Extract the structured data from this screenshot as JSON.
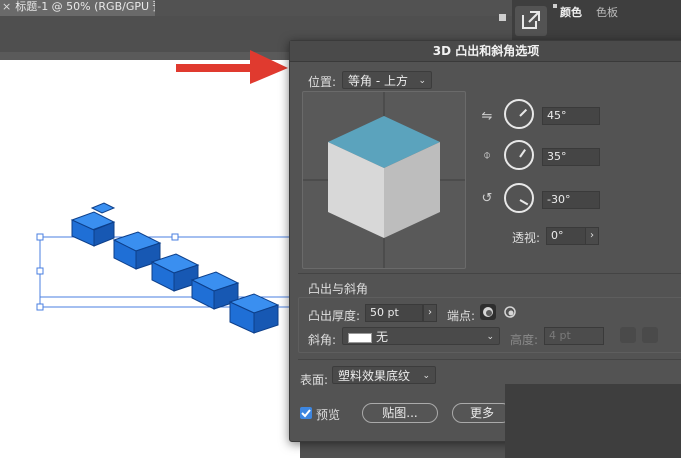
{
  "document_tab": {
    "title": "标题-1 @ 50% (RGB/GPU 预览)",
    "close_glyph": "×"
  },
  "right_panel": {
    "tabs": [
      {
        "label": "颜色"
      },
      {
        "label": "色板"
      }
    ]
  },
  "dialog": {
    "title": "3D 凸出和斜角选项",
    "position": {
      "label": "位置:",
      "value": "等角 - 上方"
    },
    "rotation": {
      "x": {
        "value": "45°",
        "icon": "rotate-x-icon"
      },
      "y": {
        "value": "35°",
        "icon": "rotate-y-icon"
      },
      "z": {
        "value": "-30°",
        "icon": "rotate-z-icon"
      },
      "perspective": {
        "label": "透视:",
        "value": "0°"
      }
    },
    "cube_colors": {
      "top": "#5ba3bd",
      "left": "#d8d8d8",
      "right": "#bdbdbd"
    },
    "extrude_section": {
      "heading": "凸出与斜角",
      "depth_label": "凸出厚度:",
      "depth_value": "50 pt",
      "cap_label": "端点:",
      "bevel_label": "斜角:",
      "bevel_value": "无",
      "height_label": "高度:",
      "height_value": "4 pt"
    },
    "surface": {
      "label": "表面:",
      "value": "塑料效果底纹"
    },
    "footer": {
      "preview_label": "预览",
      "preview_checked": true,
      "map_button": "贴图...",
      "more_button": "更多"
    }
  },
  "colors": {
    "accent_arrow": "#e03a2f",
    "text_art": "#1f6fd6",
    "selection": "#4a7fe0"
  }
}
